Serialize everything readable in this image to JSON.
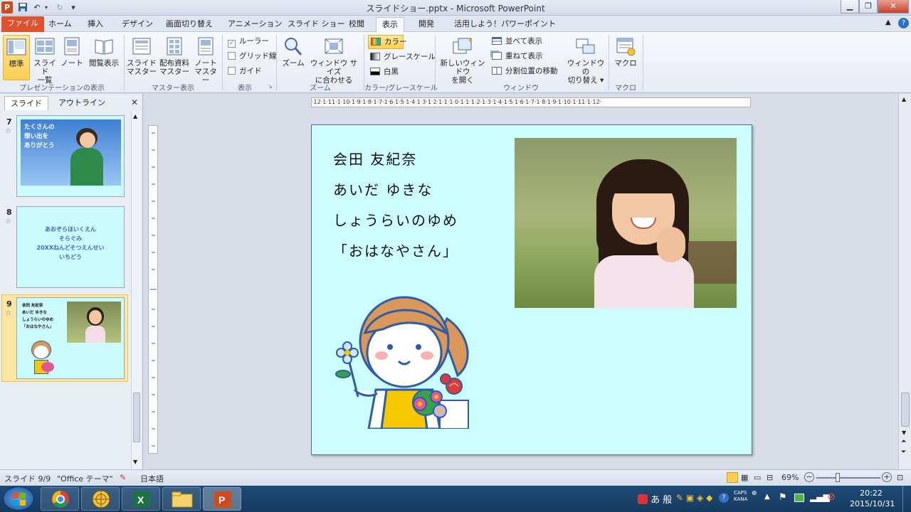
{
  "window": {
    "title": "スライドショー.pptx - Microsoft PowerPoint",
    "app_icon": "P"
  },
  "tabs": [
    "ファイル",
    "ホーム",
    "挿入",
    "デザイン",
    "画面切り替え",
    "アニメーション",
    "スライド ショー",
    "校閲",
    "表示",
    "開発",
    "活用しよう！パワーポイント"
  ],
  "active_tab": "表示",
  "ribbon": {
    "presentation_views": {
      "label": "プレゼンテーションの表示",
      "normal": "標準",
      "slide_sorter_l1": "スライド",
      "slide_sorter_l2": "一覧",
      "notes": "ノート",
      "reading": "閲覧表示"
    },
    "master_views": {
      "label": "マスター表示",
      "slide_master_l1": "スライド",
      "slide_master_l2": "マスター",
      "handout_l1": "配布資料",
      "handout_l2": "マスター",
      "notes_master_l1": "ノート",
      "notes_master_l2": "マスター"
    },
    "show": {
      "label": "表示",
      "ruler": "ルーラー",
      "gridlines": "グリッド線",
      "guides": "ガイド"
    },
    "zoom": {
      "label": "ズーム",
      "zoom": "ズーム",
      "fit_l1": "ウィンドウ サイズ",
      "fit_l2": "に合わせる"
    },
    "color": {
      "label": "カラー/グレースケール",
      "color": "カラー",
      "grayscale": "グレースケール",
      "bw": "白黒"
    },
    "window": {
      "label": "ウィンドウ",
      "new_window_l1": "新しいウィンドウ",
      "new_window_l2": "を開く",
      "arrange_all": "並べて表示",
      "cascade": "重ねて表示",
      "move_split": "分割位置の移動",
      "switch_l1": "ウィンドウの",
      "switch_l2": "切り替え ▾"
    },
    "macros": {
      "label": "マクロ",
      "macros": "マクロ"
    }
  },
  "left_pane": {
    "tab_slides": "スライド",
    "tab_outline": "アウトライン",
    "slides": [
      {
        "num": "7",
        "text_l1": "たくさんの",
        "text_l2": "想い出を",
        "text_l3": "ありがとう"
      },
      {
        "num": "8",
        "text_l1": "あおぞらほいくえん",
        "text_l2": "そらぐみ",
        "text_l3": "20XXねんどそつえんせい",
        "text_l4": "いちどう"
      },
      {
        "num": "9",
        "text_l1": "会田 友紀奈",
        "text_l2": "あいだ ゆきな",
        "text_l3": "しょうらいのゆめ",
        "text_l4": "「おはなやさん」"
      }
    ]
  },
  "slide": {
    "line1": "会田 友紀奈",
    "line2": "あいだ ゆきな",
    "line3": "しょうらいのゆめ",
    "line4": "「おはなやさん」"
  },
  "ruler_text": "·12·1·11·1·10·1·9·1·8·1·7·1·6·1·5·1·4·1·3·1·2·1·1·1·0·1·1·1·2·1·3·1·4·1·5·1·6·1·7·1·8·1·9·1·10·1·11·1·12·",
  "status": {
    "slide_count": "スライド 9/9",
    "theme": "\"Office テーマ\"",
    "language": "日本語",
    "zoom": "69%"
  },
  "taskbar": {
    "time": "20:22",
    "date": "2015/10/31",
    "ime": "あ 般",
    "caps": "CAPS",
    "kana": "KANA"
  },
  "colors": {
    "file_tab": "#e0522e",
    "slide_bg": "#ccfeff",
    "selected_thumb": "#f7c44b",
    "taskbar": "#1f4b78"
  }
}
